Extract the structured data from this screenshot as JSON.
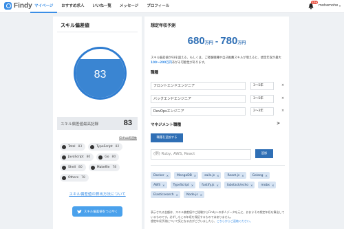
{
  "header": {
    "logo_text": "Findy",
    "nav": [
      {
        "label": "マイページ",
        "active": true
      },
      {
        "label": "おすすめ求人",
        "active": false
      },
      {
        "label": "いいね一覧",
        "active": false
      },
      {
        "label": "メッセージ",
        "active": false
      },
      {
        "label": "プロフィール",
        "active": false
      }
    ],
    "notification_count": "179",
    "username": "mohemohe",
    "caret": "▾"
  },
  "left": {
    "title": "スキル偏差値",
    "gauge_value": "83",
    "gauge_fill_fraction": 0.79,
    "max_label": "スキル偏差値最高記録",
    "max_value": "83",
    "github_link": "GitHub再連携",
    "skills": [
      {
        "name": "Total",
        "value": "83"
      },
      {
        "name": "TypeScript",
        "value": "82"
      },
      {
        "name": "JavaScript",
        "value": "80"
      },
      {
        "name": "Go",
        "value": "80"
      },
      {
        "name": "Shell",
        "value": "80"
      },
      {
        "name": "Makefile",
        "value": "78"
      },
      {
        "name": "Others",
        "value": "78"
      }
    ],
    "calc_link": "スキル偏差値の算出方法について",
    "tweet_button": "スキル偏差値をつぶやく"
  },
  "right": {
    "title": "想定年収予測",
    "salary_low": "680",
    "salary_high": "780",
    "salary_unit": "万円",
    "salary_dash": "-",
    "desc_1": "スキル偏差値が93を超える、もしくは、ご経験職種や自己推薦スキルが増えると、想定年収が最大",
    "desc_highlight": "100〜200万円",
    "desc_2": "あがる可能性があります。",
    "jobs_label": "職種",
    "jobs": [
      {
        "name": "フロントエンドエンジニア",
        "years": "3〜5年"
      },
      {
        "name": "バックエンドエンジニア",
        "years": "3〜5年"
      },
      {
        "name": "DevOpsエンジニア",
        "years": "2〜3年"
      }
    ],
    "remove_mark": "×",
    "mgmt_label": "マネジメント職種",
    "mgmt_arrow": ">",
    "add_mgmt_button": "職種を追加する",
    "skill_placeholder": "(例) Ruby, AWS, React",
    "add_button": "追加",
    "tags": [
      "Docker",
      "MongoDB",
      "sails.js",
      "React.js",
      "Golang",
      "AWS",
      "TypeScript",
      "fastify.js",
      "labstack/echo",
      "mobx",
      "Elasticsearch",
      "Node.js"
    ],
    "foot_1": "表示される金額は、スキル偏差値やご経験からFindyへの求人データを元に、おおよその想定年収を算出しているものです。必ずしもこの年収を保証するものではありません。",
    "foot_2": "想定年収予測について気になる点がございましたら、",
    "foot_link": "こちらからご連絡ください。"
  }
}
